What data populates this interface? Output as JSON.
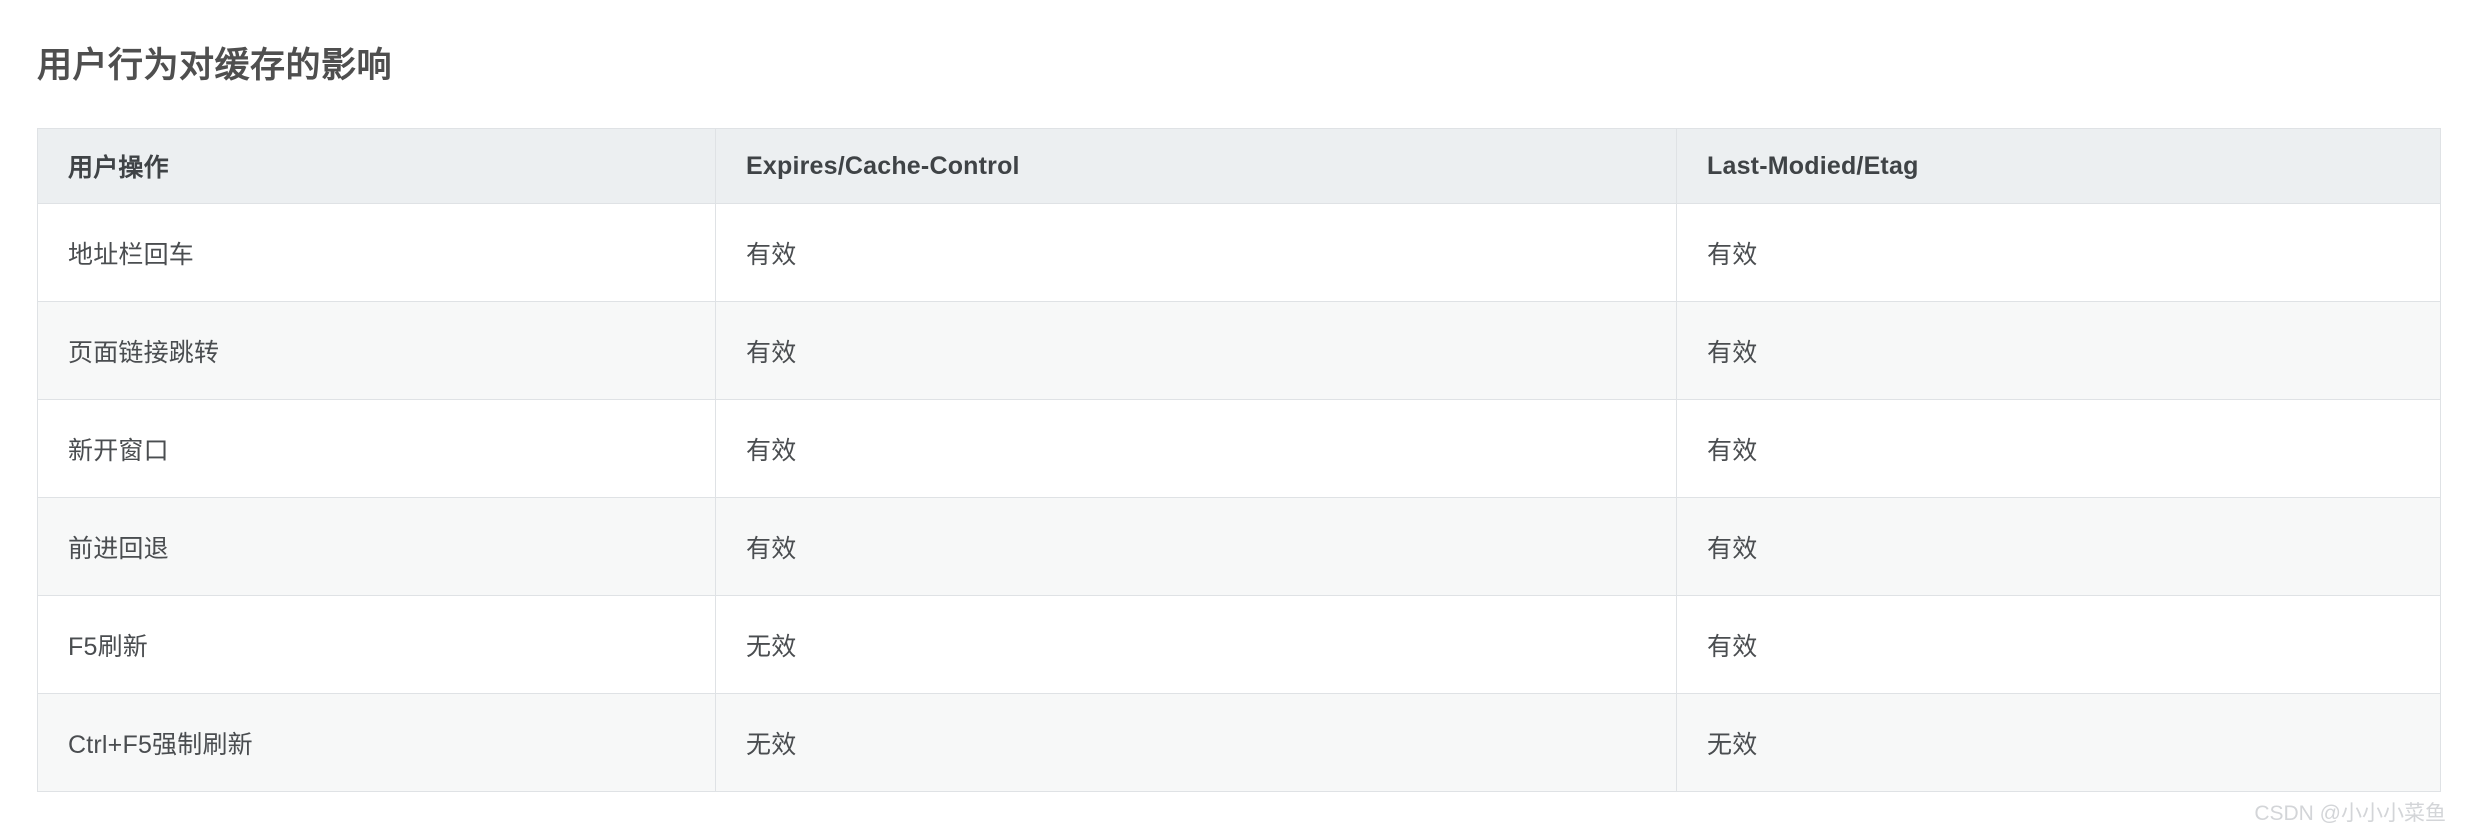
{
  "page": {
    "title": "用户行为对缓存的影响",
    "background_color": "#ffffff",
    "title_color": "#4f4f4f"
  },
  "table": {
    "header_background": "#eceff1",
    "border_color": "#dfe2e5",
    "stripe_color": "#f7f8f8",
    "columns": [
      {
        "key": "action",
        "label": "用户操作"
      },
      {
        "key": "expires",
        "label": "Expires/Cache-Control"
      },
      {
        "key": "lastmod",
        "label": "Last-Modied/Etag"
      }
    ],
    "rows": [
      {
        "action": "地址栏回车",
        "expires": "有效",
        "lastmod": "有效"
      },
      {
        "action": "页面链接跳转",
        "expires": "有效",
        "lastmod": "有效"
      },
      {
        "action": "新开窗口",
        "expires": "有效",
        "lastmod": "有效"
      },
      {
        "action": "前进回退",
        "expires": "有效",
        "lastmod": "有效"
      },
      {
        "action": "F5刷新",
        "expires": "无效",
        "lastmod": "有效"
      },
      {
        "action": "Ctrl+F5强制刷新",
        "expires": "无效",
        "lastmod": "无效"
      }
    ]
  },
  "watermark": {
    "text": "CSDN @小小小菜鱼"
  }
}
